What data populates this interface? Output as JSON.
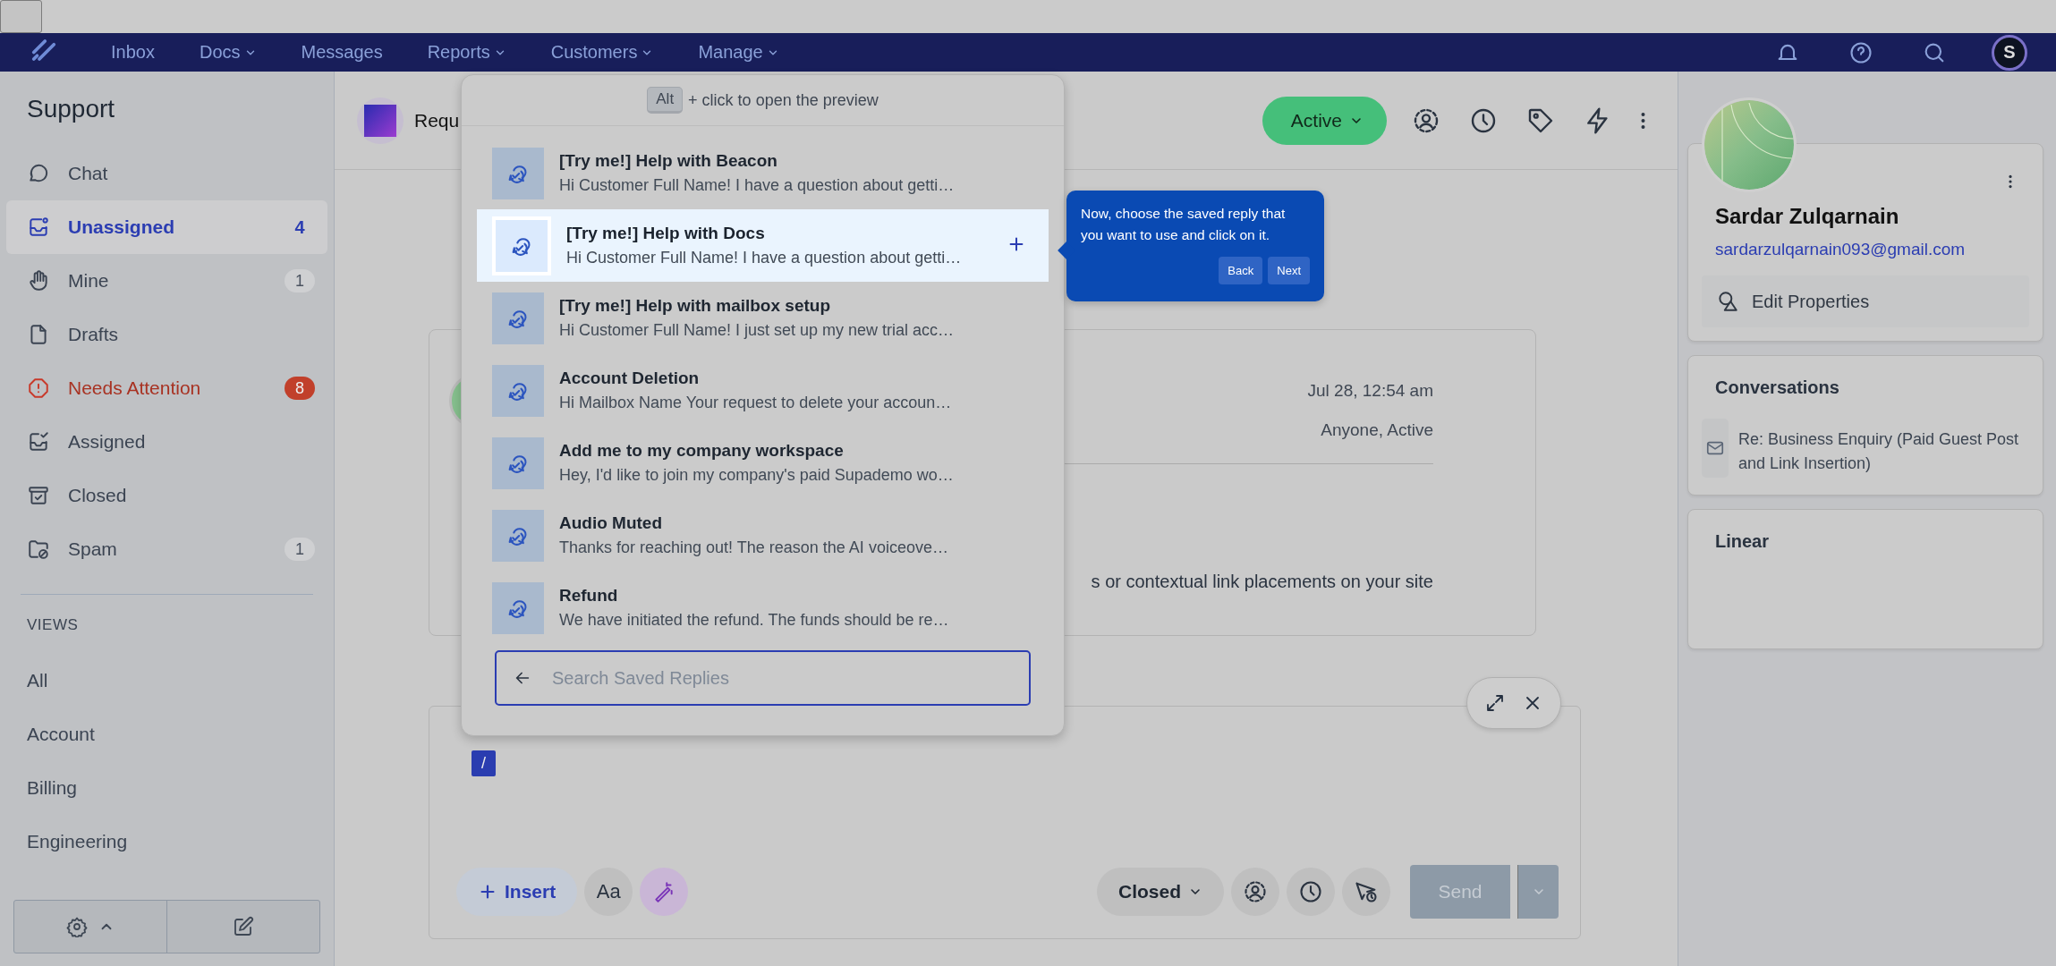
{
  "nav": {
    "items": [
      {
        "label": "Inbox",
        "dropdown": false
      },
      {
        "label": "Docs",
        "dropdown": true
      },
      {
        "label": "Messages",
        "dropdown": false
      },
      {
        "label": "Reports",
        "dropdown": true
      },
      {
        "label": "Customers",
        "dropdown": true
      },
      {
        "label": "Manage",
        "dropdown": true
      }
    ],
    "avatar_letter": "S"
  },
  "sidebar": {
    "title": "Support",
    "items": [
      {
        "label": "Chat",
        "selected": false,
        "kind": "normal"
      },
      {
        "label": "Unassigned",
        "count": "4",
        "selected": true,
        "kind": "normal"
      },
      {
        "label": "Mine",
        "count": "1",
        "selected": false,
        "kind": "normal"
      },
      {
        "label": "Drafts",
        "selected": false,
        "kind": "normal"
      },
      {
        "label": "Needs Attention",
        "count": "8",
        "selected": false,
        "kind": "alert"
      },
      {
        "label": "Assigned",
        "selected": false,
        "kind": "normal"
      },
      {
        "label": "Closed",
        "selected": false,
        "kind": "normal"
      },
      {
        "label": "Spam",
        "count": "1",
        "selected": false,
        "kind": "normal"
      }
    ],
    "views_heading": "VIEWS",
    "views": [
      "All",
      "Account",
      "Billing",
      "Engineering"
    ]
  },
  "conversation": {
    "title": "Requ",
    "status": "Active"
  },
  "message": {
    "date": "Jul 28, 12:54 am",
    "assignee": "Anyone, Active",
    "body": "s or contextual link placements on your site"
  },
  "composer": {
    "slash": "/",
    "insert": "Insert",
    "format": "Aa",
    "status": "Closed",
    "send": "Send"
  },
  "saved_replies": {
    "hint_key": "Alt",
    "hint": "+ click to open the preview",
    "items": [
      {
        "title": "[Try me!] Help with Beacon",
        "preview": "Hi Customer Full Name! I have a question about getti…",
        "selected": false
      },
      {
        "title": "[Try me!] Help with Docs",
        "preview": "Hi Customer Full Name! I have a question about getti…",
        "selected": true
      },
      {
        "title": "[Try me!] Help with mailbox setup",
        "preview": "Hi Customer Full Name! I just set up my new trial acc…",
        "selected": false
      },
      {
        "title": "Account Deletion",
        "preview": "Hi Mailbox Name Your request to delete your accoun…",
        "selected": false
      },
      {
        "title": "Add me to my company workspace",
        "preview": "Hey, I'd like to join my company's paid Supademo wo…",
        "selected": false
      },
      {
        "title": "Audio Muted",
        "preview": "Thanks for reaching out! The reason the AI voiceove…",
        "selected": false
      },
      {
        "title": "Refund",
        "preview": "We have initiated the refund. The funds should be re…",
        "selected": false
      }
    ],
    "search_placeholder": "Search Saved Replies"
  },
  "tooltip": {
    "text": "Now, choose the saved reply that you want to use and click on it.",
    "buttons": [
      "Back",
      "Next"
    ]
  },
  "customer": {
    "name": "Sardar Zulqarnain",
    "email": "sardarzulqarnain093@gmail.com",
    "edit": "Edit Properties"
  },
  "conversations": {
    "heading": "Conversations",
    "items": [
      "Re: Business Enquiry (Paid Guest Post and Link Insertion)"
    ]
  },
  "linear": {
    "heading": "Linear"
  }
}
